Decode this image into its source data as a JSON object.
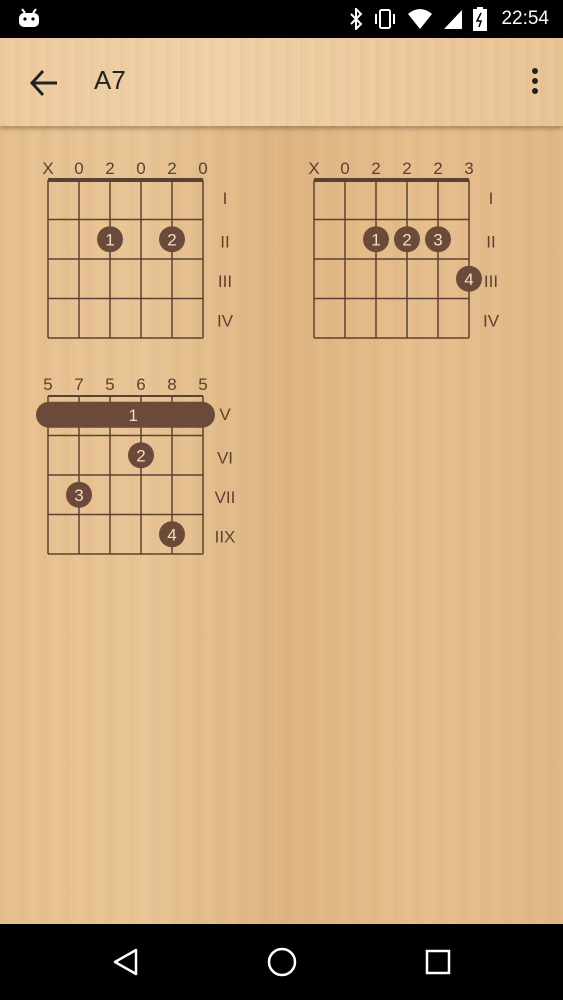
{
  "status_bar": {
    "time": "22:54",
    "icons": [
      "android-icon",
      "bluetooth-icon",
      "vibrate-icon",
      "wifi-icon",
      "signal-icon",
      "battery-icon"
    ]
  },
  "app_bar": {
    "title": "A7",
    "icons": [
      "back-arrow-icon",
      "overflow-menu-icon"
    ]
  },
  "chord_diagrams": [
    {
      "string_labels": [
        "X",
        "0",
        "2",
        "0",
        "2",
        "0"
      ],
      "fret_labels": [
        "I",
        "II",
        "III",
        "IV"
      ],
      "fingers": [
        {
          "string": 3,
          "fret": 2,
          "finger": "1"
        },
        {
          "string": 5,
          "fret": 2,
          "finger": "2"
        }
      ],
      "barre": null,
      "nut": true
    },
    {
      "string_labels": [
        "X",
        "0",
        "2",
        "2",
        "2",
        "3"
      ],
      "fret_labels": [
        "I",
        "II",
        "III",
        "IV"
      ],
      "fingers": [
        {
          "string": 3,
          "fret": 2,
          "finger": "1"
        },
        {
          "string": 4,
          "fret": 2,
          "finger": "2"
        },
        {
          "string": 5,
          "fret": 2,
          "finger": "3"
        },
        {
          "string": 6,
          "fret": 3,
          "finger": "4"
        }
      ],
      "barre": null,
      "nut": true
    },
    {
      "string_labels": [
        "5",
        "7",
        "5",
        "6",
        "8",
        "5"
      ],
      "fret_labels": [
        "V",
        "VI",
        "VII",
        "IIX"
      ],
      "fingers": [
        {
          "string": 4,
          "fret": 2,
          "finger": "2"
        },
        {
          "string": 2,
          "fret": 3,
          "finger": "3"
        },
        {
          "string": 5,
          "fret": 4,
          "finger": "4"
        }
      ],
      "barre": {
        "fret": 1,
        "finger": "1"
      },
      "nut": false
    }
  ],
  "nav_bar": {
    "icons": [
      "back-triangle-icon",
      "home-circle-icon",
      "recents-square-icon"
    ]
  },
  "colors": {
    "wood": "#e2b987",
    "ink": "#5a4232",
    "dot": "#6b4a3a",
    "dot_text": "#f3dcc0"
  }
}
